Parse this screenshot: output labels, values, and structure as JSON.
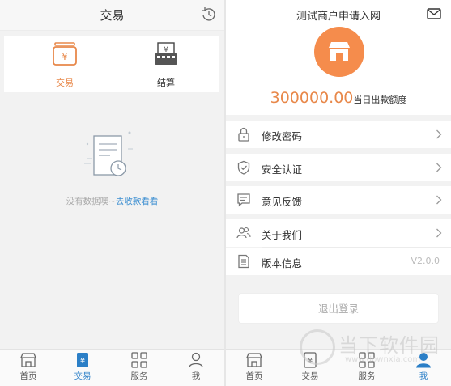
{
  "left": {
    "header": {
      "title": "交易"
    },
    "tabs": [
      {
        "label": "交易",
        "icon": "yen-wallet-icon",
        "active": true
      },
      {
        "label": "结算",
        "icon": "yen-register-icon",
        "active": false
      }
    ],
    "empty": {
      "text": "没有数据噢~",
      "link": "去收款看看"
    },
    "nav": [
      {
        "label": "首页",
        "icon": "store-icon"
      },
      {
        "label": "交易",
        "icon": "yen-card-icon",
        "active": true
      },
      {
        "label": "服务",
        "icon": "grid-icon"
      },
      {
        "label": "我",
        "icon": "person-icon"
      }
    ]
  },
  "right": {
    "header": {
      "merchant_name": "测试商户申请入网"
    },
    "amount": {
      "value": "300000.00",
      "label": "当日出款额度"
    },
    "menu": [
      {
        "label": "修改密码",
        "icon": "lock-icon"
      },
      {
        "label": "安全认证",
        "icon": "shield-icon"
      },
      {
        "label": "意见反馈",
        "icon": "feedback-icon"
      },
      {
        "label": "关于我们",
        "icon": "people-icon"
      },
      {
        "label": "版本信息",
        "icon": "document-icon",
        "value": "V2.0.0"
      }
    ],
    "logout": "退出登录",
    "nav": [
      {
        "label": "首页",
        "icon": "store-icon"
      },
      {
        "label": "交易",
        "icon": "yen-card-icon"
      },
      {
        "label": "服务",
        "icon": "grid-icon"
      },
      {
        "label": "我",
        "icon": "person-icon",
        "active": true
      }
    ]
  },
  "watermark": {
    "title": "当下软件园",
    "url": "www.downxia.com"
  },
  "colors": {
    "accent_orange": "#f58c4c",
    "active_blue": "#2b7fc7",
    "link_blue": "#3d8fd1"
  }
}
